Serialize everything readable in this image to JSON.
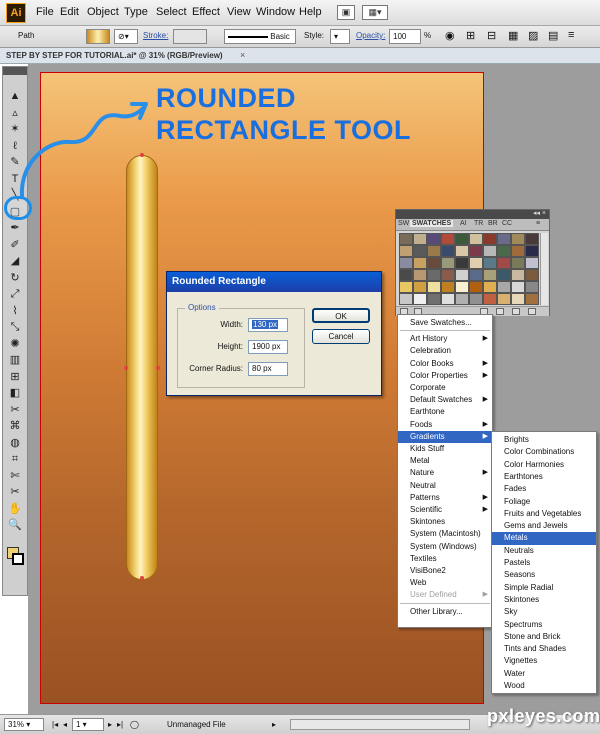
{
  "app": {
    "logo": "Ai"
  },
  "menubar": {
    "items": [
      "File",
      "Edit",
      "Object",
      "Type",
      "Select",
      "Effect",
      "View",
      "Window",
      "Help"
    ]
  },
  "controlbar": {
    "selection_label": "Path",
    "stroke_label": "Stroke:",
    "brush_label": "Basic",
    "style_label": "Style:",
    "opacity_label": "Opacity:",
    "opacity_value": "100",
    "opacity_unit": "%"
  },
  "document": {
    "tab_title": "STEP BY STEP FOR TUTORIAL.ai* @ 31% (RGB/Preview)",
    "close": "×"
  },
  "annotation": {
    "line1": "ROUNDED",
    "line2": "RECTANGLE TOOL",
    "color": "#1a6fe0"
  },
  "dialog": {
    "title": "Rounded Rectangle",
    "legend": "Options",
    "width_label": "Width:",
    "width_value": "130 px",
    "height_label": "Height:",
    "height_value": "1900 px",
    "radius_label": "Corner Radius:",
    "radius_value": "80 px",
    "ok": "OK",
    "cancel": "Cancel"
  },
  "swatches": {
    "tabs": [
      "SW",
      "SWATCHES",
      "AI",
      "TR",
      "BR",
      "CC"
    ],
    "colors": [
      "#7a6a5a",
      "#c0b090",
      "#5a4a7a",
      "#b04a3a",
      "#3a5a3a",
      "#d0c0a0",
      "#8a3a2a",
      "#6a6a8a",
      "#a08a5a",
      "#4a3a3a",
      "#c0a070",
      "#5a5a5a",
      "#9a7a4a",
      "#3a4a6a",
      "#d8c8a8",
      "#7a3a4a",
      "#b8b8b8",
      "#4a6a4a",
      "#a06a3a",
      "#2a2a4a",
      "#8a8aa0",
      "#c8a060",
      "#6a4a3a",
      "#9a9a7a",
      "#3a3a3a",
      "#e0d0b0",
      "#5a7a8a",
      "#a04a4a",
      "#7a7a5a",
      "#c0c0d0",
      "#4a4a4a",
      "#b89870",
      "#6a6a6a",
      "#8a5a4a",
      "#d0d0d0",
      "#5a6a8a",
      "#a8a078",
      "#3a5a6a",
      "#c8b8a0",
      "#7a5a3a",
      "#e8c860",
      "#d0a040",
      "#f0e0a0",
      "#c08020",
      "#f8f0d0",
      "#b06010",
      "#e0b050",
      "#a8a8a8",
      "#d8d8d8",
      "#888888",
      "#c8c8c8",
      "#f0f0f0",
      "#707070",
      "#e0e0e0",
      "#b0b0b0",
      "#909090",
      "#c06040",
      "#d8b070",
      "#e8d8b8",
      "#a07040"
    ],
    "footer_icons": [
      "library-icon",
      "show-kinds-icon",
      "options-icon",
      "new-group-icon",
      "new-swatch-icon",
      "delete-icon"
    ]
  },
  "library_menu": {
    "items": [
      {
        "label": "Save Swatches...",
        "arrow": false
      },
      {
        "label": "Art History",
        "arrow": true
      },
      {
        "label": "Celebration",
        "arrow": false
      },
      {
        "label": "Color Books",
        "arrow": true
      },
      {
        "label": "Color Properties",
        "arrow": true
      },
      {
        "label": "Corporate",
        "arrow": false
      },
      {
        "label": "Default Swatches",
        "arrow": true
      },
      {
        "label": "Earthtone",
        "arrow": false
      },
      {
        "label": "Foods",
        "arrow": true
      },
      {
        "label": "Gradients",
        "arrow": true,
        "selected": true
      },
      {
        "label": "Kids Stuff",
        "arrow": false
      },
      {
        "label": "Metal",
        "arrow": false
      },
      {
        "label": "Nature",
        "arrow": true
      },
      {
        "label": "Neutral",
        "arrow": false
      },
      {
        "label": "Patterns",
        "arrow": true
      },
      {
        "label": "Scientific",
        "arrow": true
      },
      {
        "label": "Skintones",
        "arrow": false
      },
      {
        "label": "System (Macintosh)",
        "arrow": false
      },
      {
        "label": "System (Windows)",
        "arrow": false
      },
      {
        "label": "Textiles",
        "arrow": false
      },
      {
        "label": "VisiBone2",
        "arrow": false
      },
      {
        "label": "Web",
        "arrow": false
      },
      {
        "label": "User Defined",
        "arrow": true,
        "disabled": true
      },
      {
        "label": "Other Library...",
        "arrow": false
      }
    ]
  },
  "gradients_menu": {
    "items": [
      "Brights",
      "Color Combinations",
      "Color Harmonies",
      "Earthtones",
      "Fades",
      "Foliage",
      "Fruits and Vegetables",
      "Gems and Jewels",
      "Metals",
      "Neutrals",
      "Pastels",
      "Seasons",
      "Simple Radial",
      "Skintones",
      "Sky",
      "Spectrums",
      "Stone and Brick",
      "Tints and Shades",
      "Vignettes",
      "Water",
      "Wood"
    ],
    "selected": "Metals"
  },
  "tools": [
    "selection-tool",
    "direct-selection-tool",
    "magic-wand-tool",
    "lasso-tool",
    "pen-tool",
    "type-tool",
    "line-tool",
    "rounded-rectangle-tool",
    "paintbrush-tool",
    "pencil-tool",
    "eraser-tool",
    "rotate-tool",
    "scale-tool",
    "warp-tool",
    "free-transform-tool",
    "symbol-sprayer-tool",
    "column-graph-tool",
    "mesh-tool",
    "gradient-tool",
    "eyedropper-tool",
    "blend-tool",
    "live-paint-tool",
    "crop-tool",
    "slice-tool",
    "scissors-tool",
    "hand-tool",
    "zoom-tool"
  ],
  "statusbar": {
    "zoom": "31%",
    "page": "1",
    "status": "Unmanaged File"
  },
  "watermark": "pxleyes.com"
}
